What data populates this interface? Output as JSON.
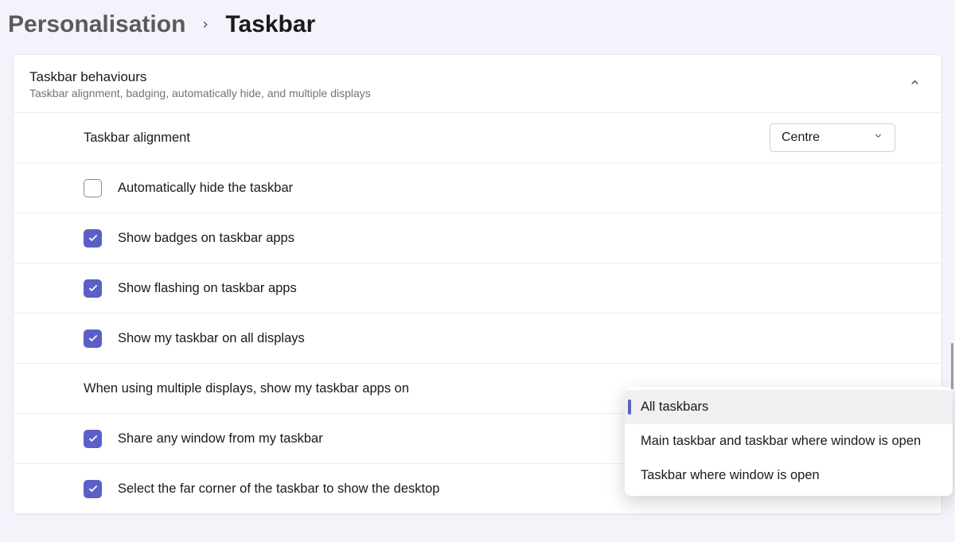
{
  "breadcrumb": {
    "parent": "Personalisation",
    "current": "Taskbar"
  },
  "section": {
    "title": "Taskbar behaviours",
    "subtitle": "Taskbar alignment, badging, automatically hide, and multiple displays"
  },
  "alignment": {
    "label": "Taskbar alignment",
    "value": "Centre"
  },
  "options": {
    "auto_hide": "Automatically hide the taskbar",
    "badges": "Show badges on taskbar apps",
    "flashing": "Show flashing on taskbar apps",
    "all_displays": "Show my taskbar on all displays",
    "multi_display_label": "When using multiple displays, show my taskbar apps on",
    "share_window": "Share any window from my taskbar",
    "far_corner": "Select the far corner of the taskbar to show the desktop"
  },
  "dropdown": {
    "items": [
      "All taskbars",
      "Main taskbar and taskbar where window is open",
      "Taskbar where window is open"
    ]
  }
}
